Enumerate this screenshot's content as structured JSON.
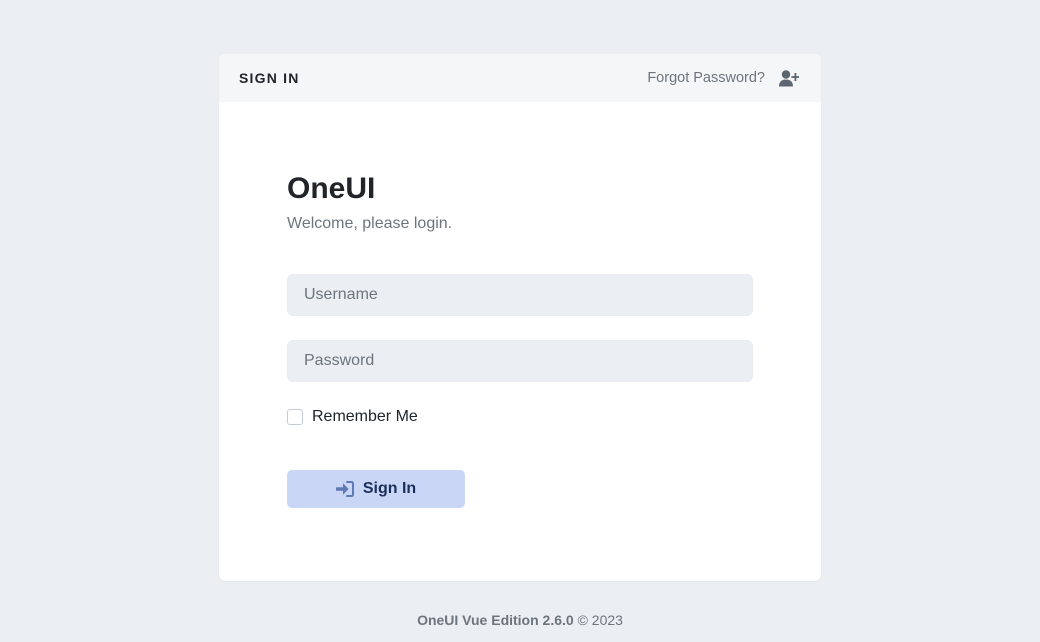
{
  "header": {
    "title": "SIGN IN",
    "forgot_password": "Forgot Password?",
    "add_user_icon": "user-plus-icon"
  },
  "brand": {
    "title": "OneUI",
    "subtitle": "Welcome, please login."
  },
  "form": {
    "username_placeholder": "Username",
    "username_value": "",
    "password_placeholder": "Password",
    "password_value": "",
    "remember_label": "Remember Me",
    "remember_checked": false,
    "submit_label": "Sign In",
    "submit_icon": "sign-in-icon"
  },
  "footer": {
    "product": "OneUI Vue Edition 2.6.0",
    "copyright": "© 2023"
  },
  "colors": {
    "background": "#ebeef2",
    "accent_button": "#c9d6f5",
    "button_text": "#1c2e5c"
  }
}
